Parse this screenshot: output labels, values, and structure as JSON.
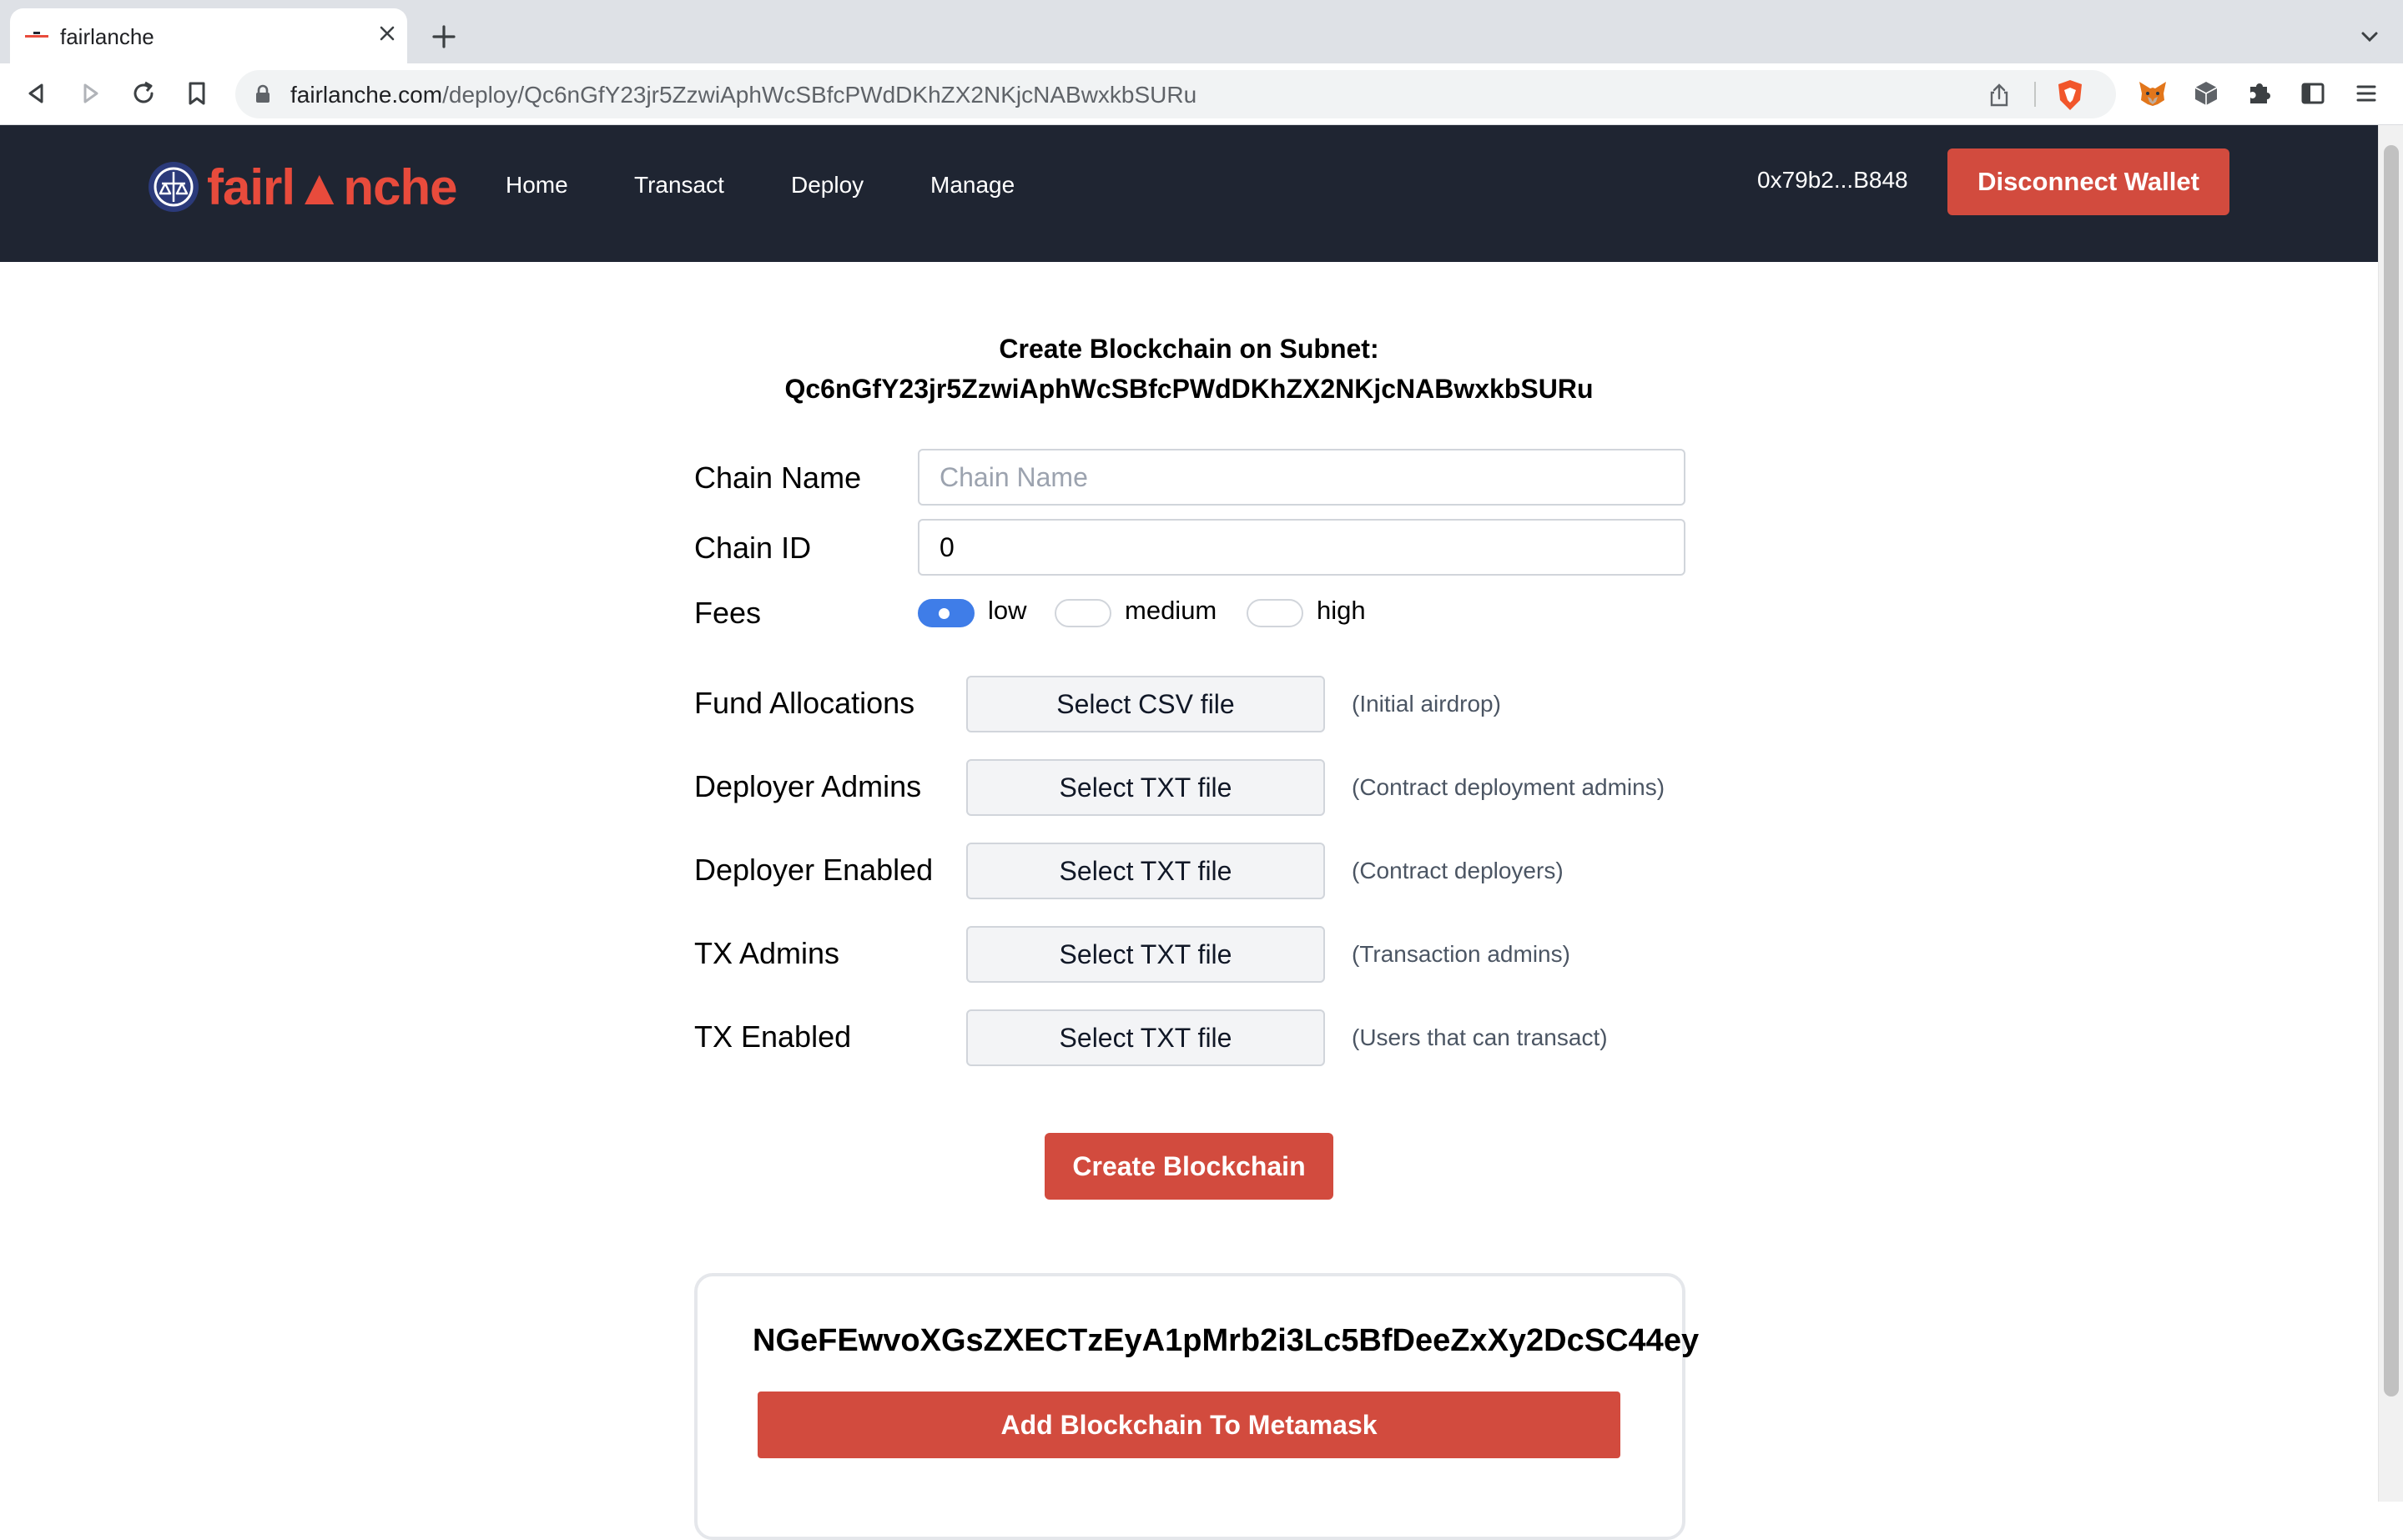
{
  "browser": {
    "tab_title": "fairlanche",
    "url_host": "fairlanche.com",
    "url_path": "/deploy/Qc6nGfY23jr5ZzwiAphWcSBfcPWdDKhZX2NKjcNABwxkbSURu"
  },
  "header": {
    "logo_text": "fairl▲nche",
    "nav": [
      "Home",
      "Transact",
      "Deploy",
      "Manage"
    ],
    "wallet_address": "0x79b2...B848",
    "disconnect_label": "Disconnect Wallet"
  },
  "form": {
    "title_line1": "Create Blockchain on Subnet:",
    "title_line2": "Qc6nGfY23jr5ZzwiAphWcSBfcPWdDKhZX2NKjcNABwxkbSURu",
    "chain_name_label": "Chain Name",
    "chain_name_placeholder": "Chain Name",
    "chain_name_value": "",
    "chain_id_label": "Chain ID",
    "chain_id_value": "0",
    "fees_label": "Fees",
    "fees_options": [
      "low",
      "medium",
      "high"
    ],
    "fees_selected": "low",
    "files": [
      {
        "label": "Fund Allocations",
        "button": "Select CSV file",
        "hint": "(Initial airdrop)"
      },
      {
        "label": "Deployer Admins",
        "button": "Select TXT file",
        "hint": "(Contract deployment admins)"
      },
      {
        "label": "Deployer Enabled",
        "button": "Select TXT file",
        "hint": "(Contract deployers)"
      },
      {
        "label": "TX Admins",
        "button": "Select TXT file",
        "hint": "(Transaction admins)"
      },
      {
        "label": "TX Enabled",
        "button": "Select TXT file",
        "hint": "(Users that can transact)"
      }
    ],
    "create_label": "Create Blockchain"
  },
  "result": {
    "blockchain_id": "NGeFEwvoXGsZXECTzEyA1pMrb2i3Lc5BfDeeZxXy2DcSC44ey",
    "add_metamask_label": "Add Blockchain To Metamask"
  },
  "colors": {
    "accent": "#d24b3e",
    "header_bg": "#1f2532",
    "toggle_on": "#3f7de8"
  },
  "icons": [
    "back-icon",
    "forward-icon",
    "reload-icon",
    "bookmark-icon",
    "lock-icon",
    "share-icon",
    "brave-shield-icon",
    "metamask-fox-icon",
    "cube-icon",
    "puzzle-extensions-icon",
    "sidebar-icon",
    "menu-icon",
    "close-icon",
    "plus-icon",
    "chevron-down-icon"
  ]
}
